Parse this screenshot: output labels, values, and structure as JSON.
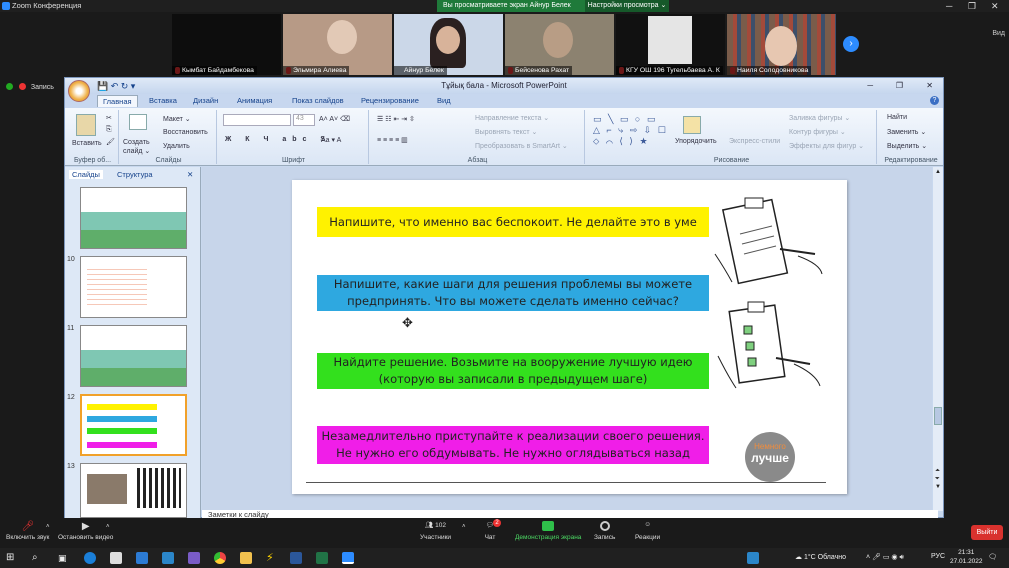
{
  "zoom": {
    "window_title": "Zoom Конференция",
    "share_banner": "Вы просматриваете экран Айнур Белек",
    "view_options": "Настройки просмотра ⌄",
    "view_label": "Вид"
  },
  "participants": [
    {
      "name": "Кымбат Байдамбекова",
      "muted": true,
      "color": "#0d0d0d"
    },
    {
      "name": "Эльмира Алиева",
      "muted": true,
      "color": "#b79a86"
    },
    {
      "name": "Айнур Белек",
      "muted": false,
      "color": "#cbd7e8"
    },
    {
      "name": "Бейсенова Рахат",
      "muted": true,
      "color": "#8c8270"
    },
    {
      "name": "КГУ ОШ 196 Тугельбаева А. К",
      "muted": true,
      "color": "#111"
    },
    {
      "name": "Наиля Солодовникова",
      "muted": true,
      "color": "#6c5548"
    }
  ],
  "recording": {
    "label": "Запись"
  },
  "ppt": {
    "title": "Тұйық бала - Microsoft PowerPoint",
    "tabs": [
      "Главная",
      "Вставка",
      "Дизайн",
      "Анимация",
      "Показ слайдов",
      "Рецензирование",
      "Вид"
    ],
    "ribbon": {
      "paste": "Вставить",
      "create_slide": "Создать слайд ⌄",
      "layout": "Макет ⌄",
      "reset": "Восстановить",
      "delete": "Удалить",
      "font_size": "43",
      "text_direction": "Направление текста ⌄",
      "align_text": "Выровнять текст ⌄",
      "smartart": "Преобразовать в SmartArt ⌄",
      "arrange": "Упорядочить",
      "quick_styles": "Экспресс-стили",
      "shape_fill": "Заливка фигуры ⌄",
      "shape_outline": "Контур фигуры ⌄",
      "shape_effects": "Эффекты для фигур ⌄",
      "find": "Найти",
      "replace": "Заменить ⌄",
      "select": "Выделить ⌄",
      "groups": {
        "clipboard": "Буфер об...",
        "slides": "Слайды",
        "font": "Шрифт",
        "paragraph": "Абзац",
        "drawing": "Рисование",
        "editing": "Редактирование"
      }
    },
    "pane_tabs": {
      "slides": "Слайды",
      "outline": "Структура"
    },
    "thumbnails": [
      {
        "num": "",
        "style": "green"
      },
      {
        "num": "10",
        "style": "text"
      },
      {
        "num": "11",
        "style": "green"
      },
      {
        "num": "12",
        "style": "current"
      },
      {
        "num": "13",
        "style": "photo"
      }
    ],
    "slide": {
      "steps": [
        {
          "text": "Напишите, что именно вас беспокоит. Не делайте это в уме",
          "color": "#fff200"
        },
        {
          "text": "Напишите, какие шаги для решения проблемы вы можете предпринять. Что вы можете сделать именно сейчас?",
          "color": "#2ea8e0"
        },
        {
          "text": "Найдите решение. Возьмите на вооружение лучшую идею (которую вы записали в предыдущем шаге)",
          "color": "#33e01d"
        },
        {
          "text": "Незамедлительно приступайте к реализации своего решения. Не нужно его обдумывать. Не нужно оглядываться назад",
          "color": "#f01ee8"
        }
      ],
      "badge_line1": "Немного",
      "badge_line2": "лучше"
    },
    "notes_placeholder": "Заметки к слайду"
  },
  "toolbar": {
    "unmute": "Включить звук",
    "video": "Остановить видео",
    "participants_count": "102",
    "participants": "Участники",
    "chat_badge": "2",
    "chat": "Чат",
    "share": "Демонстрация экрана",
    "record": "Запись",
    "reactions": "Реакции",
    "leave": "Выйти"
  },
  "taskbar": {
    "weather": "1°C Облачно",
    "lang": "РУС",
    "time": "21:31",
    "date": "27.01.2022"
  }
}
